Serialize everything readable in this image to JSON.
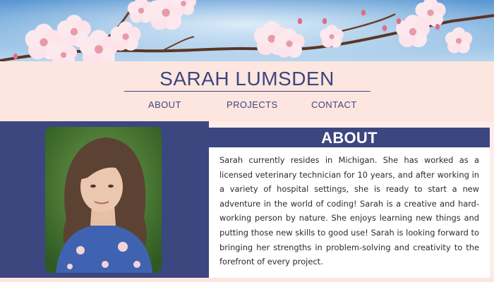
{
  "site": {
    "title": "SARAH LUMSDEN"
  },
  "nav": {
    "items": [
      {
        "label": "ABOUT"
      },
      {
        "label": "PROJECTS"
      },
      {
        "label": "CONTACT"
      }
    ]
  },
  "about": {
    "heading": "ABOUT",
    "text": "Sarah currently resides in Michigan. She has worked as a licensed veterinary technician for 10 years, and after working in a variety of hospital settings, she is ready to start a new adventure in the world of coding! Sarah is a creative and hard-working person by nature. She enjoys learning new things and putting those new skills to good use! Sarah is looking forward to bringing her strengths in problem-solving and creativity to the forefront of every project."
  },
  "colors": {
    "brand_navy": "#3c467f",
    "header_pink": "#fde6e0",
    "sky_blue": "#6fa8db",
    "text": "#2b2b2b"
  },
  "icons": {
    "banner": "cherry-blossom-branch-image",
    "portrait": "profile-photo"
  }
}
